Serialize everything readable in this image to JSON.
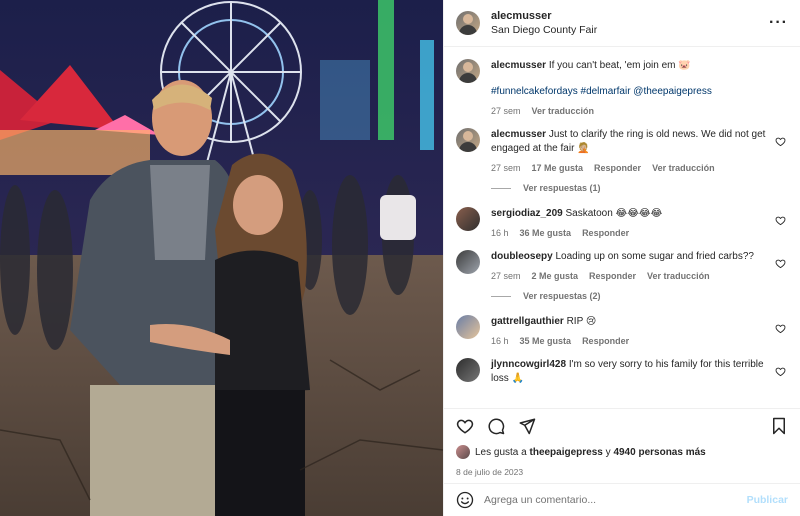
{
  "post": {
    "username": "alecmusser",
    "location": "San Diego County Fair",
    "more_icon": "more-horizontal-icon"
  },
  "caption": {
    "username": "alecmusser",
    "text": "If you can't beat, 'em join em 🐷",
    "tags": "#funnelcakefordays #delmarfair @theepaigepress",
    "time": "27 sem",
    "translate": "Ver traducción"
  },
  "comments": [
    {
      "username": "alecmusser",
      "text": "Just to clarify the ring is old news. We did not get engaged at the fair 🤦🏼",
      "time": "27 sem",
      "likes": "17 Me gusta",
      "reply": "Responder",
      "translate": "Ver traducción",
      "replies": "Ver respuestas (1)"
    },
    {
      "username": "sergiodiaz_209",
      "text": "Saskatoon 😂😂😂😂",
      "time": "16 h",
      "likes": "36 Me gusta",
      "reply": "Responder"
    },
    {
      "username": "doubleosepy",
      "text": "Loading up on some sugar and fried carbs??",
      "time": "27 sem",
      "likes": "2 Me gusta",
      "reply": "Responder",
      "translate": "Ver traducción",
      "replies": "Ver respuestas (2)"
    },
    {
      "username": "gattrellgauthier",
      "text": "RIP 😢",
      "time": "16 h",
      "likes": "35 Me gusta",
      "reply": "Responder"
    },
    {
      "username": "jlynncowgirl428",
      "text": "I'm so very sorry to his family for this terrible loss 🙏"
    }
  ],
  "likes": {
    "prefix": "Les gusta a",
    "user": "theepaigepress",
    "joiner": "y",
    "count": "4940 personas más"
  },
  "date": "8 de julio de 2023",
  "composer": {
    "placeholder": "Agrega un comentario...",
    "publish": "Publicar"
  },
  "colors": {
    "link": "#00376b",
    "muted": "#737373",
    "publish_disabled": "#b2dffc"
  }
}
